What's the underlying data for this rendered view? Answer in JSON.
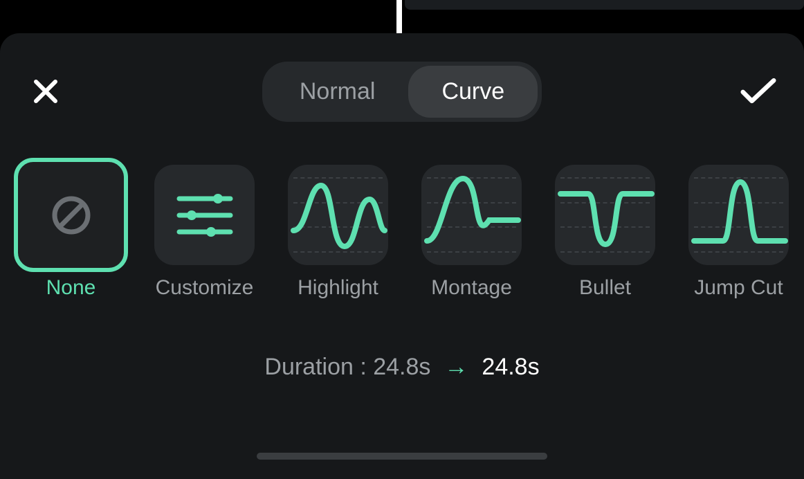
{
  "tabs": {
    "normal": "Normal",
    "curve": "Curve",
    "active": "curve"
  },
  "presets": [
    {
      "id": "none",
      "label": "None",
      "selected": true
    },
    {
      "id": "customize",
      "label": "Customize",
      "selected": false
    },
    {
      "id": "highlight",
      "label": "Highlight",
      "selected": false
    },
    {
      "id": "montage",
      "label": "Montage",
      "selected": false
    },
    {
      "id": "bullet",
      "label": "Bullet",
      "selected": false
    },
    {
      "id": "jump-cut",
      "label": "Jump Cut",
      "selected": false
    }
  ],
  "duration": {
    "label": "Duration : 24.8s",
    "arrow": "→",
    "result": "24.8s"
  },
  "colors": {
    "accent": "#5ee0b0"
  }
}
